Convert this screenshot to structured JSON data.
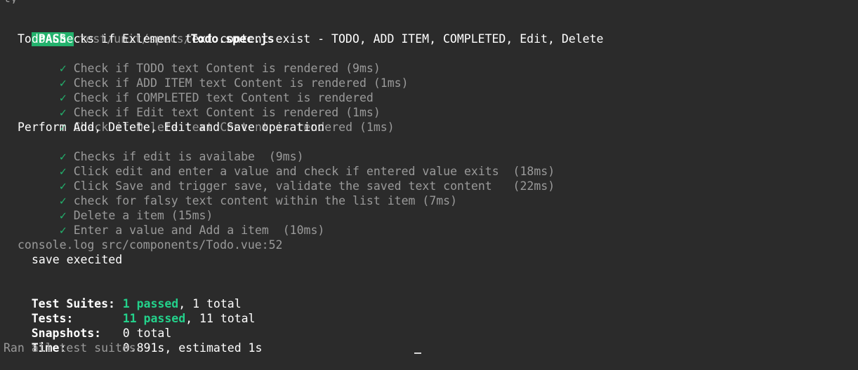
{
  "top_cut_text": "ty",
  "header": {
    "badge": "PASS",
    "path_prefix": "test/unit/specs/",
    "file_name": "Todo.spec.js"
  },
  "suites": [
    {
      "title": "Todo Checks if Exlement text content exist - TODO, ADD ITEM, COMPLETED, Edit, Delete",
      "tests": [
        "Check if TODO text Content is rendered (9ms)",
        "Check if ADD ITEM text Content is rendered (1ms)",
        "Check if COMPLETED text Content is rendered",
        "Check if Edit text Content is rendered (1ms)",
        "Check if Delete text Content is rendered (1ms)"
      ]
    },
    {
      "title": "Perform Add, Delete, Edit and Save operation",
      "tests": [
        "Checks if edit is availabe  (9ms)",
        "Click edit and enter a value and check if entered value exits  (18ms)",
        "Click Save and trigger save, validate the saved text content   (22ms)",
        "check for falsy text content within the list item (7ms)",
        "Delete a item (15ms)",
        "Enter a value and Add a item  (10ms)"
      ]
    }
  ],
  "check_glyph": "✓",
  "console": {
    "source": "console.log src/components/Todo.vue:52",
    "message": "save execited"
  },
  "summary": {
    "suites_label": "Test Suites:",
    "suites_passed": "1 passed",
    "suites_rest": ", 1 total",
    "tests_label": "Tests:",
    "tests_passed": "11 passed",
    "tests_rest": ", 11 total",
    "snapshots_label": "Snapshots:",
    "snapshots_value": "0 total",
    "time_label": "Time:",
    "time_value": "0.891s, estimated 1s",
    "footer": "Ran all test suites."
  },
  "colors": {
    "background": "#2b2b2b",
    "pass_badge": "#23b26d",
    "check": "#23b26d",
    "passed_text": "#23d18b",
    "muted_text": "#9a9a9a"
  }
}
